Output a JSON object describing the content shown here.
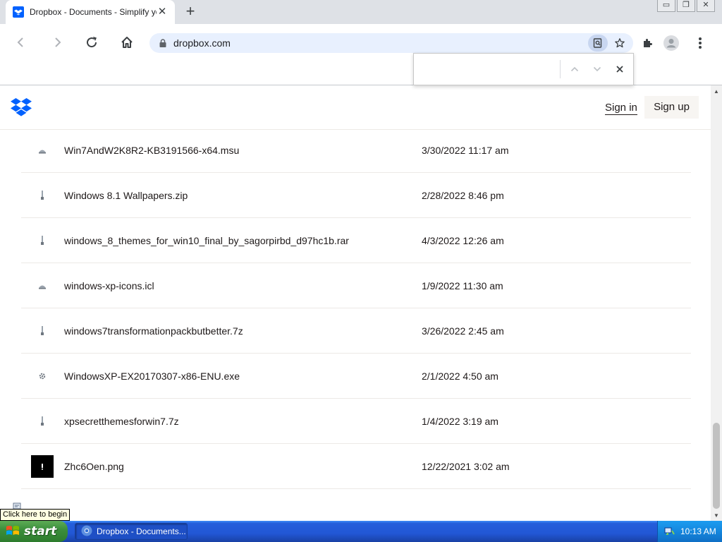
{
  "browser": {
    "tab_title": "Dropbox - Documents - Simplify your",
    "tab_close_glyph": "✕",
    "new_tab_glyph": "+",
    "window_buttons": [
      "▭",
      "❐",
      "✕"
    ],
    "url": "dropbox.com",
    "icons": [
      "back-arrow-icon",
      "forward-arrow-icon",
      "reload-icon",
      "home-icon",
      "lock-icon",
      "zoom-icon",
      "bookmark-star-icon",
      "extensions-puzzle-icon",
      "profile-icon",
      "kebab-menu-icon"
    ]
  },
  "findbar": {
    "query": "",
    "icons": [
      "chevron-up-icon",
      "chevron-down-icon",
      "close-icon"
    ]
  },
  "header": {
    "sign_in": "Sign in",
    "sign_up": "Sign up",
    "brand_color": "#0061fe"
  },
  "files": [
    {
      "name": "Win7AndW2K8R2-KB3191566-x64.msu",
      "date": "3/30/2022 11:17 am",
      "icon": "generic-file-icon"
    },
    {
      "name": "Windows 8.1 Wallpapers.zip",
      "date": "2/28/2022 8:46 pm",
      "icon": "zip-file-icon"
    },
    {
      "name": "windows_8_themes_for_win10_final_by_sagorpirbd_d97hc1b.rar",
      "date": "4/3/2022 12:26 am",
      "icon": "zip-file-icon"
    },
    {
      "name": "windows-xp-icons.icl",
      "date": "1/9/2022 11:30 am",
      "icon": "generic-file-icon"
    },
    {
      "name": "windows7transformationpackbutbetter.7z",
      "date": "3/26/2022 2:45 am",
      "icon": "zip-file-icon"
    },
    {
      "name": "WindowsXP-EX20170307-x86-ENU.exe",
      "date": "2/1/2022 4:50 am",
      "icon": "gear-file-icon"
    },
    {
      "name": "xpsecretthemesforwin7.7z",
      "date": "1/4/2022 3:19 am",
      "icon": "zip-file-icon"
    },
    {
      "name": "Zhc6Oen.png",
      "date": "12/22/2021 3:02 am",
      "icon": "image-thumbnail-icon"
    }
  ],
  "tooltip": {
    "text": "Click here to begin"
  },
  "taskbar": {
    "start_label": "start",
    "task_label": "Dropbox - Documents...",
    "clock": "10:13 AM"
  }
}
